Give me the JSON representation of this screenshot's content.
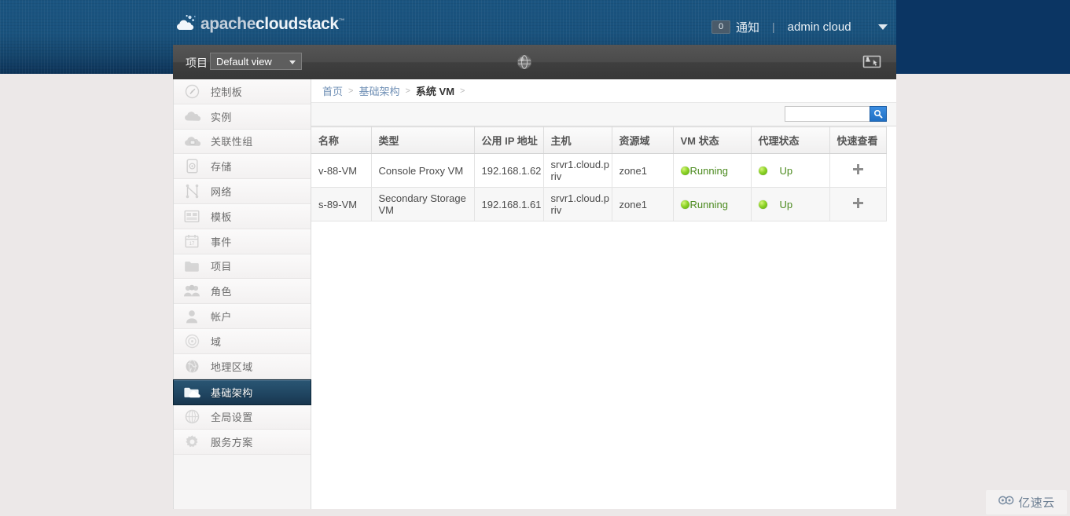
{
  "header": {
    "logo_text_part1": "apache",
    "logo_text_part2": "cloudstack",
    "logo_tm": "™",
    "logo_icon": "cloud-logo-icon",
    "notification_count": "0",
    "notification_label": "通知",
    "divider": "|",
    "user_name": "admin cloud",
    "user_caret_icon": "chevron-down-icon"
  },
  "toolbar": {
    "project_label": "项目",
    "project_select_value": "Default view",
    "project_caret_icon": "chevron-down-icon",
    "refresh_icon": "globe-refresh-icon",
    "console_icon": "console-viewer-icon"
  },
  "sidebar": {
    "items": [
      {
        "label": "控制板",
        "icon": "dashboard-icon",
        "selected": false
      },
      {
        "label": "实例",
        "icon": "instances-cloud-icon",
        "selected": false
      },
      {
        "label": "关联性组",
        "icon": "affinity-group-icon",
        "selected": false
      },
      {
        "label": "存储",
        "icon": "storage-disk-icon",
        "selected": false
      },
      {
        "label": "网络",
        "icon": "network-icon",
        "selected": false
      },
      {
        "label": "模板",
        "icon": "templates-icon",
        "selected": false
      },
      {
        "label": "事件",
        "icon": "events-calendar-icon",
        "selected": false
      },
      {
        "label": "项目",
        "icon": "projects-folder-icon",
        "selected": false
      },
      {
        "label": "角色",
        "icon": "roles-users-icon",
        "selected": false
      },
      {
        "label": "帐户",
        "icon": "accounts-user-icon",
        "selected": false
      },
      {
        "label": "域",
        "icon": "domains-icon",
        "selected": false
      },
      {
        "label": "地理区域",
        "icon": "regions-globe-icon",
        "selected": false
      },
      {
        "label": "基础架构",
        "icon": "infrastructure-icon",
        "selected": true
      },
      {
        "label": "全局设置",
        "icon": "global-settings-icon",
        "selected": false
      },
      {
        "label": "服务方案",
        "icon": "service-offerings-gear-icon",
        "selected": false
      }
    ]
  },
  "breadcrumb": {
    "items": [
      {
        "label": "首页",
        "current": false
      },
      {
        "label": "基础架构",
        "current": false
      },
      {
        "label": "系统 VM",
        "current": true
      }
    ],
    "separator": ">"
  },
  "search": {
    "value": "",
    "placeholder": "",
    "button_icon": "search-icon"
  },
  "table": {
    "columns": [
      "名称",
      "类型",
      "公用 IP 地址",
      "主机",
      "资源域",
      "VM 状态",
      "代理状态",
      "快速查看"
    ],
    "rows": [
      {
        "name": "v-88-VM",
        "type": "Console Proxy VM",
        "public_ip": "192.168.1.62",
        "host": "srvr1.cloud.priv",
        "zone": "zone1",
        "vm_state": "Running",
        "agent_state": "Up",
        "quickview_icon": "plus-icon"
      },
      {
        "name": "s-89-VM",
        "type": "Secondary Storage VM",
        "public_ip": "192.168.1.61",
        "host": "srvr1.cloud.priv",
        "zone": "zone1",
        "vm_state": "Running",
        "agent_state": "Up",
        "quickview_icon": "plus-icon"
      }
    ]
  },
  "watermark": {
    "text": "亿速云",
    "icon": "yisuyun-logo-icon"
  },
  "colors": {
    "header_blue": "#1a5480",
    "header_right_navy": "#0b3563",
    "toolbar_gray": "#474747",
    "selected_nav": "#1f4460",
    "status_green": "#4b8a1e",
    "accent_blue": "#2f7fd4",
    "page_background": "#ece8e8"
  }
}
